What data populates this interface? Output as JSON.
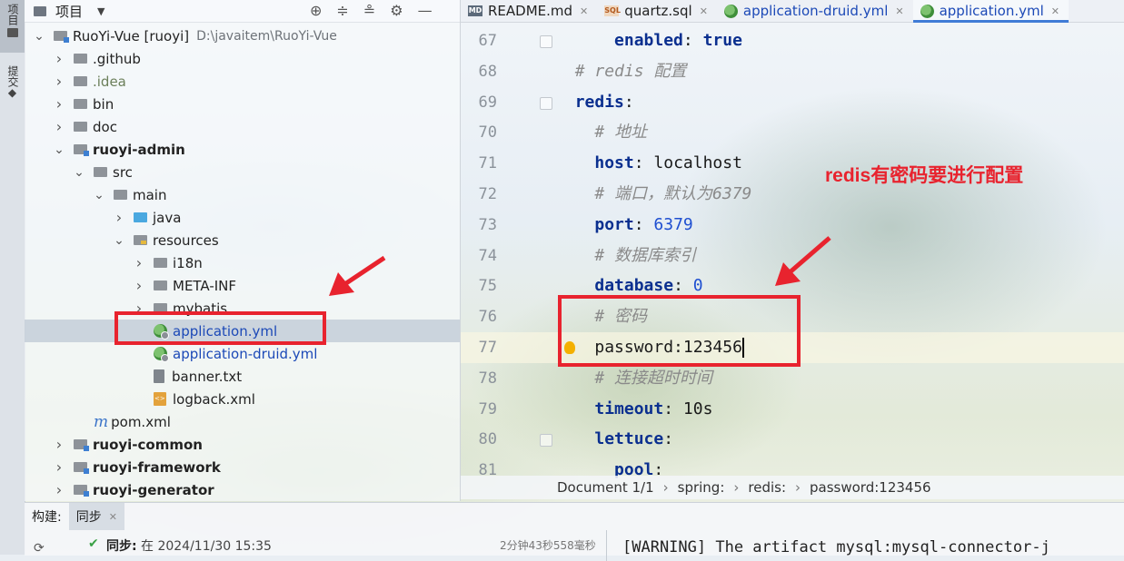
{
  "left_strip": {
    "project_tab": "项目",
    "commit_tab": "提交"
  },
  "project_panel": {
    "title": "项目",
    "tree": [
      {
        "label": "RuoYi-Vue [ruoyi]",
        "path": "D:\\javaitem\\RuoYi-Vue",
        "indent": 0,
        "expanded": true,
        "icon": "module-folder-icon",
        "bold": false
      },
      {
        "label": ".github",
        "indent": 1,
        "expanded": false,
        "icon": "folder-icon"
      },
      {
        "label": ".idea",
        "indent": 1,
        "expanded": false,
        "icon": "folder-icon",
        "muted": true
      },
      {
        "label": "bin",
        "indent": 1,
        "expanded": false,
        "icon": "folder-icon"
      },
      {
        "label": "doc",
        "indent": 1,
        "expanded": false,
        "icon": "folder-icon"
      },
      {
        "label": "ruoyi-admin",
        "indent": 1,
        "expanded": true,
        "icon": "module-folder-icon",
        "bold": true
      },
      {
        "label": "src",
        "indent": 2,
        "expanded": true,
        "icon": "folder-icon"
      },
      {
        "label": "main",
        "indent": 3,
        "expanded": true,
        "icon": "folder-icon"
      },
      {
        "label": "java",
        "indent": 4,
        "expanded": false,
        "icon": "java-folder-icon"
      },
      {
        "label": "resources",
        "indent": 4,
        "expanded": true,
        "icon": "resources-folder-icon"
      },
      {
        "label": "i18n",
        "indent": 5,
        "expanded": false,
        "icon": "folder-icon"
      },
      {
        "label": "META-INF",
        "indent": 5,
        "expanded": false,
        "icon": "folder-icon"
      },
      {
        "label": "mybatis",
        "indent": 5,
        "expanded": false,
        "icon": "folder-icon"
      },
      {
        "label": "application.yml",
        "indent": 5,
        "leaf": true,
        "icon": "yml-file-icon",
        "blue": true,
        "selected": true
      },
      {
        "label": "application-druid.yml",
        "indent": 5,
        "leaf": true,
        "icon": "yml-file-icon",
        "blue": true
      },
      {
        "label": "banner.txt",
        "indent": 5,
        "leaf": true,
        "icon": "text-file-icon"
      },
      {
        "label": "logback.xml",
        "indent": 5,
        "leaf": true,
        "icon": "xml-file-icon"
      },
      {
        "label": "pom.xml",
        "indent": 2,
        "leaf": true,
        "icon": "maven-file-icon"
      },
      {
        "label": "ruoyi-common",
        "indent": 1,
        "expanded": false,
        "icon": "module-folder-icon",
        "bold": true
      },
      {
        "label": "ruoyi-framework",
        "indent": 1,
        "expanded": false,
        "icon": "module-folder-icon",
        "bold": true
      },
      {
        "label": "ruoyi-generator",
        "indent": 1,
        "expanded": false,
        "icon": "module-folder-icon",
        "bold": true
      }
    ]
  },
  "editor_tabs": [
    {
      "label": "README.md",
      "icon": "markdown-icon",
      "active": false
    },
    {
      "label": "quartz.sql",
      "icon": "sql-icon",
      "active": false
    },
    {
      "label": "application-druid.yml",
      "icon": "yml-icon",
      "active": false
    },
    {
      "label": "application.yml",
      "icon": "yml-icon",
      "active": true
    }
  ],
  "editor": {
    "lines": [
      {
        "num": "67",
        "indent": "      ",
        "key": "enabled",
        "sep": ": ",
        "value": "true",
        "vtype": "kw"
      },
      {
        "num": "68",
        "indent": "  ",
        "comment": "# redis 配置"
      },
      {
        "num": "69",
        "indent": "  ",
        "key": "redis",
        "sep": ":",
        "value": ""
      },
      {
        "num": "70",
        "indent": "    ",
        "comment": "# 地址"
      },
      {
        "num": "71",
        "indent": "    ",
        "key": "host",
        "sep": ": ",
        "value": "localhost",
        "vtype": "v"
      },
      {
        "num": "72",
        "indent": "    ",
        "comment": "# 端口，默认为6379"
      },
      {
        "num": "73",
        "indent": "    ",
        "key": "port",
        "sep": ": ",
        "value": "6379",
        "vtype": "n"
      },
      {
        "num": "74",
        "indent": "    ",
        "comment": "# 数据库索引"
      },
      {
        "num": "75",
        "indent": "    ",
        "key": "database",
        "sep": ": ",
        "value": "0",
        "vtype": "n"
      },
      {
        "num": "76",
        "indent": "    ",
        "comment": "# 密码"
      },
      {
        "num": "77",
        "indent": "    ",
        "plain": "password:123456",
        "current": true
      },
      {
        "num": "78",
        "indent": "    ",
        "comment": "# 连接超时时间"
      },
      {
        "num": "79",
        "indent": "    ",
        "key": "timeout",
        "sep": ": ",
        "value": "10s",
        "vtype": "v"
      },
      {
        "num": "80",
        "indent": "    ",
        "key": "lettuce",
        "sep": ":",
        "value": ""
      },
      {
        "num": "81",
        "indent": "      ",
        "key": "pool",
        "sep": ":",
        "value": ""
      }
    ]
  },
  "annotation": {
    "text": "redis有密码要进行配置",
    "color": "#e8232e"
  },
  "breadcrumb": {
    "document": "Document 1/1",
    "items": [
      "spring:",
      "redis:",
      "password:123456"
    ]
  },
  "build_panel": {
    "tab_build": "构建:",
    "tab_sync": "同步",
    "sync_label": "同步:",
    "sync_time": "在 2024/11/30 15:35",
    "duration": "2分钟43秒558毫秒",
    "console_text": "[WARNING] The artifact mysql:mysql-connector-j"
  }
}
